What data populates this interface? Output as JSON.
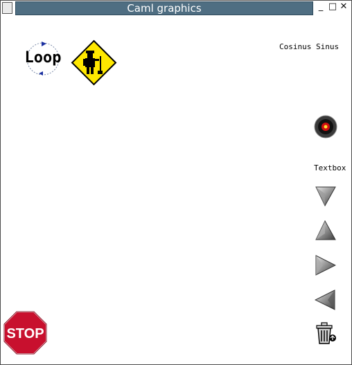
{
  "window": {
    "title": "Caml graphics"
  },
  "titlebar_buttons": {
    "minimize": "_",
    "maximize": "□",
    "close": "✕"
  },
  "loop_icon": {
    "text": "Loop"
  },
  "top_right_label": "Cosinus Sinus",
  "textbox_label": "Textbox :",
  "stop_icon": {
    "text": "STOP"
  },
  "icons": [
    "loop-icon",
    "worker-warning-icon",
    "red-eye-icon",
    "arrow-down-icon",
    "arrow-up-icon",
    "arrow-right-icon",
    "arrow-left-icon",
    "trash-icon",
    "stop-sign-icon"
  ]
}
